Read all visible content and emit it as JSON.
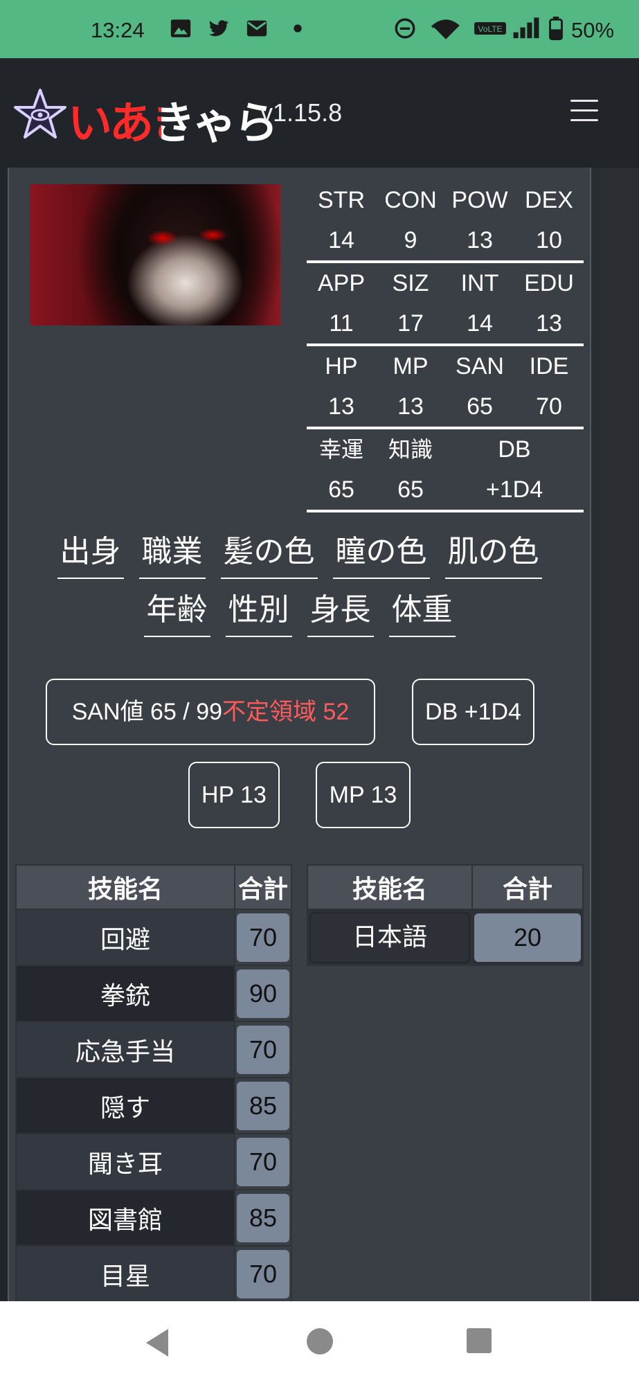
{
  "status_bar": {
    "time": "13:24",
    "icons": [
      "image-icon",
      "twitter-icon",
      "mail-icon",
      "dot-icon",
      "dnd-icon",
      "wifi-icon",
      "volte-icon",
      "signal-icon",
      "battery-icon"
    ],
    "battery": "50%"
  },
  "app": {
    "logo_text": "いあきゃら",
    "version": "v1.15.8"
  },
  "stats": {
    "rows": [
      [
        {
          "label": "STR",
          "value": "14"
        },
        {
          "label": "CON",
          "value": "9"
        },
        {
          "label": "POW",
          "value": "13"
        },
        {
          "label": "DEX",
          "value": "10"
        }
      ],
      [
        {
          "label": "APP",
          "value": "11"
        },
        {
          "label": "SIZ",
          "value": "17"
        },
        {
          "label": "INT",
          "value": "14"
        },
        {
          "label": "EDU",
          "value": "13"
        }
      ],
      [
        {
          "label": "HP",
          "value": "13"
        },
        {
          "label": "MP",
          "value": "13"
        },
        {
          "label": "SAN",
          "value": "65"
        },
        {
          "label": "IDE",
          "value": "70"
        }
      ],
      [
        {
          "label": "幸運",
          "value": "65"
        },
        {
          "label": "知識",
          "value": "65"
        },
        {
          "label": "DB",
          "value": "+1D4"
        }
      ]
    ]
  },
  "attributes": {
    "row1": [
      "出身",
      "職業",
      "髪の色",
      "瞳の色",
      "肌の色"
    ],
    "row2": [
      "年齢",
      "性別",
      "身長",
      "体重"
    ]
  },
  "summary": {
    "san_prefix": "SAN値 65 / 99",
    "san_unstable": "不定領域 52",
    "db": "DB +1D4",
    "hp": "HP 13",
    "mp": "MP 13"
  },
  "skills_left": {
    "headers": [
      "技能名",
      "合計"
    ],
    "rows": [
      {
        "name": "回避",
        "total": "70"
      },
      {
        "name": "拳銃",
        "total": "90"
      },
      {
        "name": "応急手当",
        "total": "70"
      },
      {
        "name": "隠す",
        "total": "85"
      },
      {
        "name": "聞き耳",
        "total": "70"
      },
      {
        "name": "図書館",
        "total": "85"
      },
      {
        "name": "目星",
        "total": "70"
      }
    ]
  },
  "skills_right": {
    "headers": [
      "技能名",
      "合計"
    ],
    "rows": [
      {
        "name": "日本語",
        "total": "20"
      }
    ]
  },
  "colors": {
    "status_bar": "#54b884",
    "panel": "#3a3e45",
    "unstable_text": "#ff5b5b",
    "value_box": "#7b8899"
  }
}
